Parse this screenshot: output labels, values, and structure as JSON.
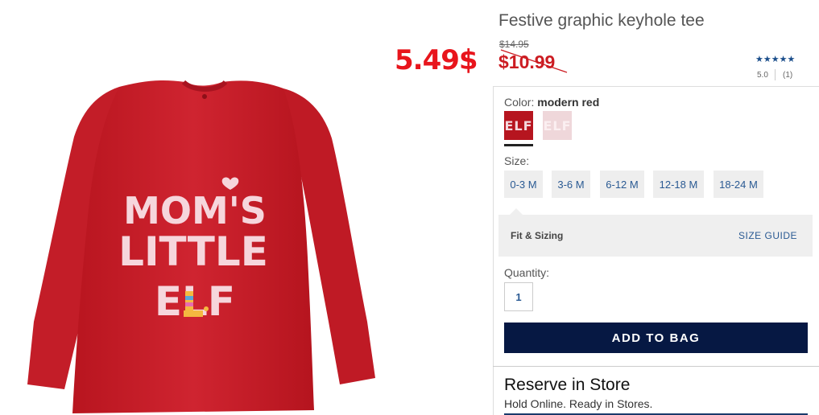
{
  "product": {
    "title": "Festive graphic keyhole tee",
    "original_price": "$14.95",
    "sale_price": "$10.99",
    "promo_overlay_price": "5.49$",
    "shirt_text_lines": [
      "MOM'S",
      "LITTLE",
      "ELF"
    ]
  },
  "rating": {
    "stars": "★★★★★",
    "value": "5.0",
    "count": "(1)"
  },
  "color": {
    "label": "Color:",
    "selected": "modern red",
    "swatches": [
      {
        "text": "ELF",
        "color": "#b6151f"
      },
      {
        "text": "ELF",
        "color": "#efd7da"
      }
    ]
  },
  "size": {
    "label": "Size:",
    "options": [
      "0-3 M",
      "3-6 M",
      "6-12 M",
      "12-18 M",
      "18-24 M"
    ]
  },
  "fit": {
    "label": "Fit & Sizing",
    "guide_link": "SIZE GUIDE"
  },
  "quantity": {
    "label": "Quantity:",
    "value": "1"
  },
  "add_to_bag": "ADD TO BAG",
  "reserve": {
    "title": "Reserve in Store",
    "subtitle": "Hold Online. Ready in Stores."
  },
  "colors": {
    "shirt": "#c8202b",
    "accent_navy": "#061843",
    "sale_red": "#cc1c22",
    "link_blue": "#2a5a93"
  }
}
